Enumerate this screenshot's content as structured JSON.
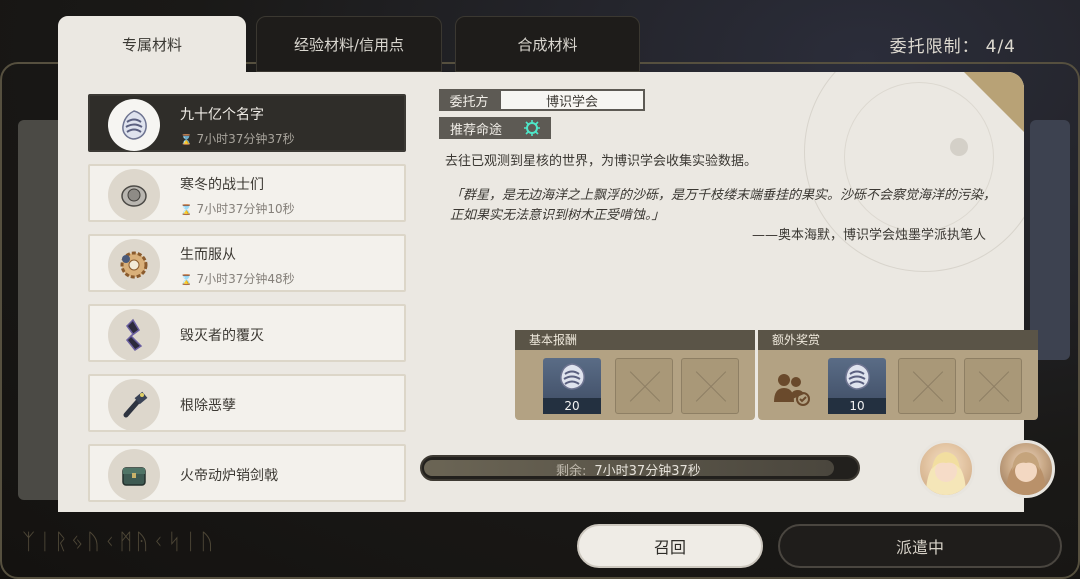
{
  "tabs": [
    {
      "label": "专属材料",
      "active": true
    },
    {
      "label": "经验材料/信用点",
      "active": false
    },
    {
      "label": "合成材料",
      "active": false
    }
  ],
  "commission_limit": {
    "label": "委托限制：",
    "value": "4/4"
  },
  "assignments": [
    {
      "name": "九十亿个名字",
      "time": "7小时37分钟37秒",
      "icon": "silvermane-badge-icon",
      "active": true
    },
    {
      "name": "寒冬的战士们",
      "time": "7小时37分钟10秒",
      "icon": "coin-icon",
      "active": false
    },
    {
      "name": "生而服从",
      "time": "7小时37分钟48秒",
      "icon": "gear-icon",
      "active": false
    },
    {
      "name": "毁灭者的覆灭",
      "time": "",
      "icon": "dark-shard-icon",
      "active": false
    },
    {
      "name": "根除恶孽",
      "time": "",
      "icon": "tool-icon",
      "active": false
    },
    {
      "name": "火帝动炉销剑戟",
      "time": "",
      "icon": "chest-icon",
      "active": false
    }
  ],
  "detail": {
    "client_label": "委托方",
    "client_value": "博识学会",
    "path_label": "推荐命途",
    "path_icon": "erudition-path-icon",
    "description": "去往已观测到星核的世界，为博识学会收集实验数据。",
    "quote": "「群星，是无边海洋之上飘浮的沙砾，是万千枝缕末端垂挂的果实。沙砾不会察觉海洋的污染，正如果实无法意识到树木正受啃蚀。」",
    "quote_author": "——奥本海默，博识学会烛墨学派执笔人"
  },
  "rewards": {
    "basic_label": "基本报酬",
    "basic_count": "20",
    "extra_label": "额外奖赏",
    "extra_count": "10"
  },
  "timer": {
    "label": "剩余:",
    "value": "7小时37分钟37秒",
    "progress": 0.95
  },
  "buttons": {
    "recall": "召回",
    "dispatch": "派遣中"
  },
  "colors": {
    "panel": "#ebe8e2",
    "accent_gold": "#b3a283",
    "dark": "#2f2d29"
  }
}
